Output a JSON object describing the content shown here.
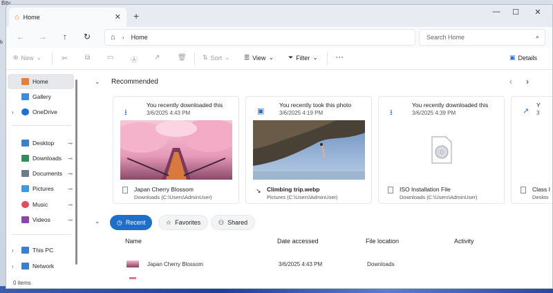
{
  "desktop": {
    "label": "Bitv",
    "tick": "b"
  },
  "window": {
    "tab_title": "Home",
    "tab_close": "✕",
    "new_tab": "+",
    "minimize": "—",
    "maximize": "☐",
    "close": "✕"
  },
  "address": {
    "back": "←",
    "forward": "→",
    "up": "↑",
    "refresh": "↻",
    "home_icon": "⌂",
    "separator": "›",
    "crumb": "Home",
    "search_placeholder": "Search Home",
    "search_icon": "⌕"
  },
  "toolbar": {
    "new_label": "New",
    "sort_label": "Sort",
    "view_label": "View",
    "filter_label": "Filter",
    "more": "···",
    "details_label": "Details"
  },
  "sidebar": {
    "items": [
      {
        "label": "Home",
        "icon": "home-icon",
        "color": "#e67e3a"
      },
      {
        "label": "Gallery",
        "icon": "gallery-icon",
        "color": "#3a8de6"
      },
      {
        "label": "OneDrive",
        "icon": "cloud-icon",
        "color": "#1e6fd6"
      },
      {
        "label": "Desktop",
        "icon": "desktop-icon",
        "color": "#3a7fd0"
      },
      {
        "label": "Downloads",
        "icon": "download-icon",
        "color": "#2f8f57"
      },
      {
        "label": "Documents",
        "icon": "document-icon",
        "color": "#6d7a8a"
      },
      {
        "label": "Pictures",
        "icon": "picture-icon",
        "color": "#3a9be6"
      },
      {
        "label": "Music",
        "icon": "music-icon",
        "color": "#e04f5f"
      },
      {
        "label": "Videos",
        "icon": "video-icon",
        "color": "#8e44ad"
      },
      {
        "label": "This PC",
        "icon": "computer-icon",
        "color": "#3a7fd0"
      },
      {
        "label": "Network",
        "icon": "network-icon",
        "color": "#3a7fd0"
      }
    ],
    "pin": "📌"
  },
  "main": {
    "recommended_title": "Recommended",
    "cards": [
      {
        "action": "You recently downloaded this",
        "date": "3/6/2025 4:43 PM",
        "name": "Japan Cherry Blossom",
        "location": "Downloads (C:\\Users\\AdminUser)",
        "icon": "download-icon"
      },
      {
        "action": "You recently took this photo",
        "date": "3/6/2025 4:19 PM",
        "name": "Climbing trip.webp",
        "location": "Pictures (C:\\Users\\AdminUser)",
        "icon": "picture-icon"
      },
      {
        "action": "You recently downloaded this",
        "date": "3/6/2025 4:39 PM",
        "name": "ISO Installation File",
        "location": "Downloads (C:\\Users\\AdminUser)",
        "icon": "download-icon"
      },
      {
        "action": "Y",
        "date": "3",
        "name": "Class I",
        "location": "Deskto",
        "icon": "share-icon"
      }
    ],
    "tabs": [
      {
        "label": "Recent",
        "icon": "clock-icon"
      },
      {
        "label": "Favorites",
        "icon": "star-icon"
      },
      {
        "label": "Shared",
        "icon": "people-icon"
      }
    ],
    "columns": [
      "Name",
      "Date accessed",
      "File location",
      "Activity"
    ],
    "rows": [
      {
        "name": "Japan Cherry Blossom",
        "date": "3/6/2025 4:43 PM",
        "location": "Downloads"
      }
    ]
  },
  "status": {
    "items": "0 items"
  }
}
